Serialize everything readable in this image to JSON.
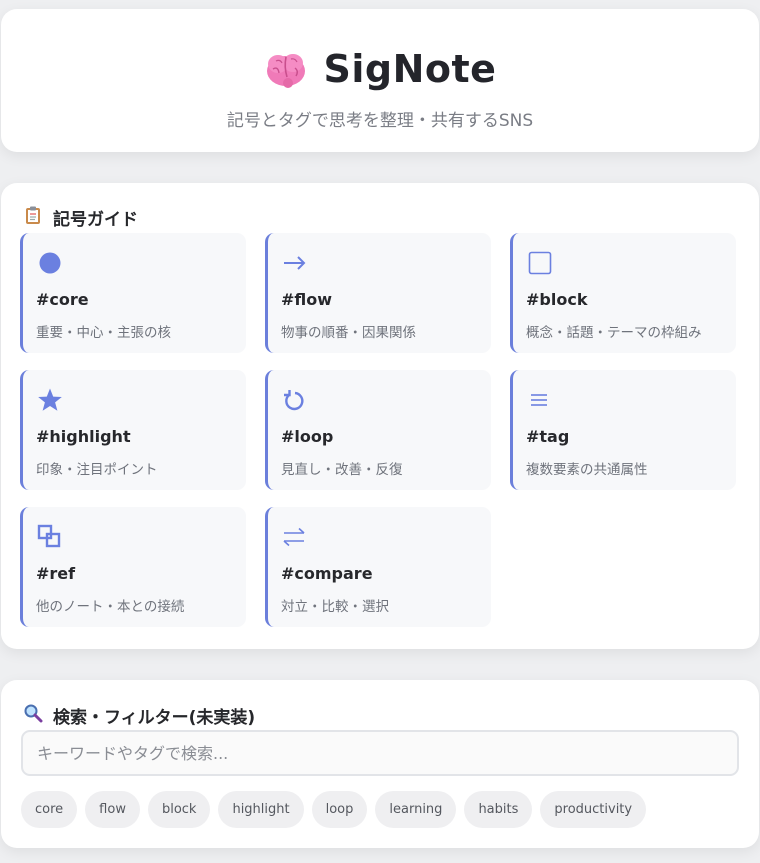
{
  "header": {
    "title": "SigNote",
    "subtitle": "記号とタグで思考を整理・共有するSNS",
    "logo_icon": "brain-icon"
  },
  "guide": {
    "title": "記号ガイド",
    "icon": "clipboard-icon",
    "symbols": [
      {
        "icon": "circle-icon",
        "name": "#core",
        "desc": "重要・中心・主張の核"
      },
      {
        "icon": "arrow-right-icon",
        "name": "#flow",
        "desc": "物事の順番・因果関係"
      },
      {
        "icon": "square-icon",
        "name": "#block",
        "desc": "概念・話題・テーマの枠組み"
      },
      {
        "icon": "star-icon",
        "name": "#highlight",
        "desc": "印象・注目ポイント"
      },
      {
        "icon": "loop-icon",
        "name": "#loop",
        "desc": "見直し・改善・反復"
      },
      {
        "icon": "equals-icon",
        "name": "#tag",
        "desc": "複数要素の共通属性"
      },
      {
        "icon": "overlap-squares-icon",
        "name": "#ref",
        "desc": "他のノート・本との接続"
      },
      {
        "icon": "swap-arrows-icon",
        "name": "#compare",
        "desc": "対立・比較・選択"
      }
    ]
  },
  "search": {
    "title": "検索・フィルター(未実装)",
    "icon": "magnifier-icon",
    "placeholder": "キーワードやタグで検索...",
    "tags": [
      "core",
      "flow",
      "block",
      "highlight",
      "loop",
      "learning",
      "habits",
      "productivity"
    ]
  },
  "colors": {
    "accent": "#6b80e0",
    "background": "#eeeff1",
    "card": "#ffffff",
    "symbol_card": "#f7f8fa"
  }
}
